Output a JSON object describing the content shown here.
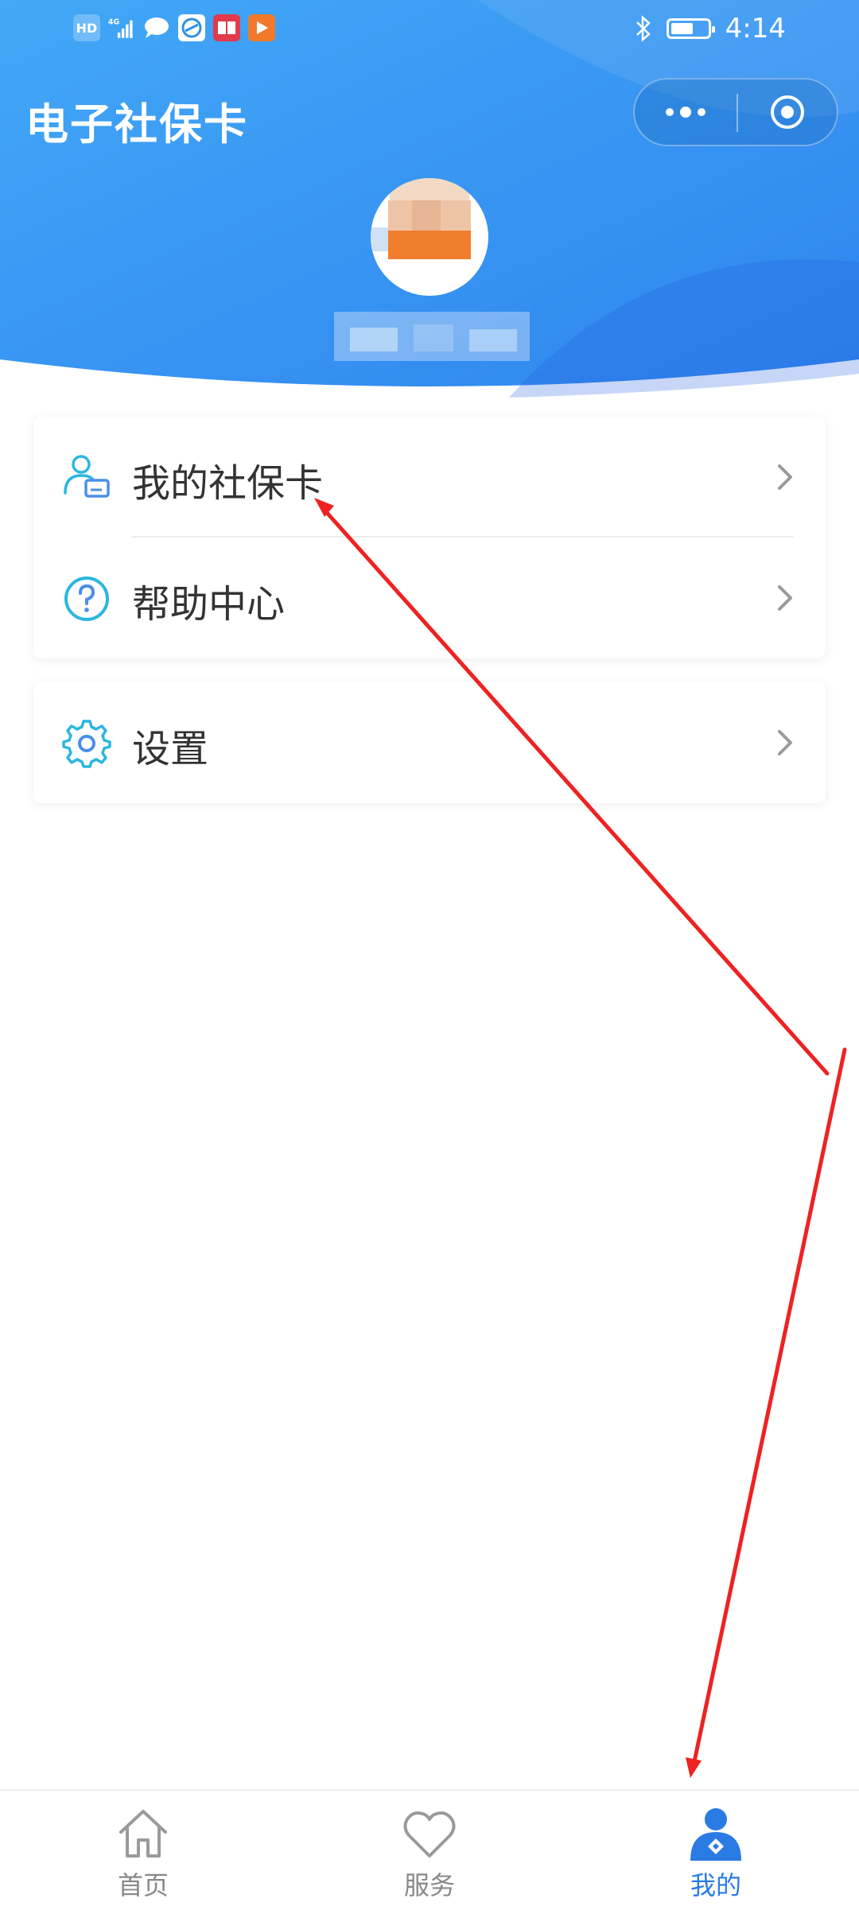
{
  "status_bar": {
    "icons": [
      "hd-icon",
      "signal-4g-icon",
      "chat-icon",
      "browser-icon",
      "reader-icon",
      "video-icon"
    ],
    "hd_label": "HD",
    "network_label": "4G",
    "time": "4:14",
    "battery_level": 0.55
  },
  "header": {
    "title": "电子社保卡",
    "gradient_start": "#3aa0f5",
    "gradient_end": "#2f86ee"
  },
  "menu_card_1": {
    "items": [
      {
        "label": "我的社保卡",
        "icon": "social-security-card-user-icon"
      },
      {
        "label": "帮助中心",
        "icon": "help-circle-icon"
      }
    ]
  },
  "menu_card_2": {
    "items": [
      {
        "label": "设置",
        "icon": "gear-icon"
      }
    ]
  },
  "tabbar": {
    "tabs": [
      {
        "label": "首页",
        "icon": "home-icon",
        "active": false
      },
      {
        "label": "服务",
        "icon": "heart-icon",
        "active": false
      },
      {
        "label": "我的",
        "icon": "profile-icon",
        "active": true
      }
    ],
    "active_color": "#2a7be4",
    "inactive_color": "#888888"
  },
  "colors": {
    "accent": "#2a7be4",
    "icon_cyan": "#2bb6e0",
    "annotation_red": "#ee2222"
  }
}
